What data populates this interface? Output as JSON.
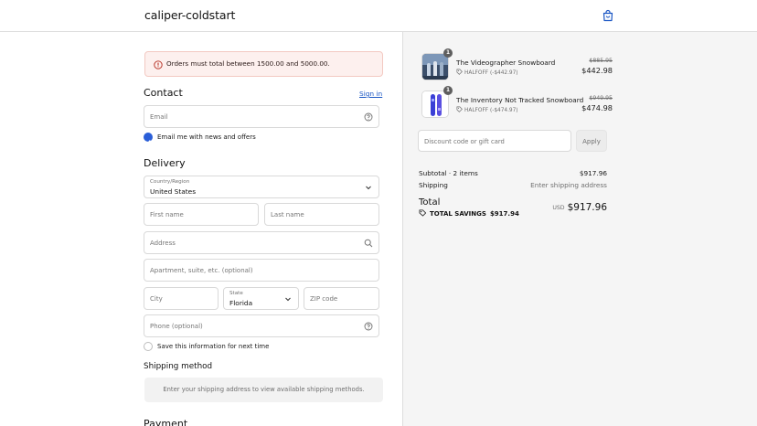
{
  "header": {
    "store_name": "caliper-coldstart",
    "cart_icon": "shopping-bag-icon"
  },
  "banner": {
    "icon": "warning-icon",
    "text": "Orders must total between 1500.00 and 5000.00."
  },
  "contact": {
    "heading": "Contact",
    "sign_in": "Sign in",
    "email_placeholder": "Email",
    "email_help_icon": "help-icon",
    "news_label": "Email me with news and offers",
    "news_checked": true
  },
  "delivery": {
    "heading": "Delivery",
    "country_label": "Country/Region",
    "country_value": "United States",
    "first_name_placeholder": "First name",
    "last_name_placeholder": "Last name",
    "address_placeholder": "Address",
    "apartment_placeholder": "Apartment, suite, etc. (optional)",
    "city_placeholder": "City",
    "state_label": "State",
    "state_value": "Florida",
    "zip_placeholder": "ZIP code",
    "phone_placeholder": "Phone (optional)",
    "save_info_label": "Save this information for next time",
    "save_info_checked": false
  },
  "shipping_method": {
    "heading": "Shipping method",
    "notice": "Enter your shipping address to view available shipping methods."
  },
  "payment": {
    "heading": "Payment"
  },
  "order": {
    "items": [
      {
        "name": "The Videographer Snowboard",
        "quantity": "1",
        "discount": "HALFOFF (-$442.97)",
        "original_price": "$885.95",
        "price": "$442.98"
      },
      {
        "name": "The Inventory Not Tracked Snowboard",
        "quantity": "1",
        "discount": "HALFOFF (-$474.97)",
        "original_price": "$949.95",
        "price": "$474.98"
      }
    ],
    "discount_placeholder": "Discount code or gift card",
    "apply_label": "Apply",
    "subtotal_label": "Subtotal · 2 items",
    "subtotal_value": "$917.96",
    "shipping_label": "Shipping",
    "shipping_value": "Enter shipping address",
    "total_label": "Total",
    "total_currency": "USD",
    "total_value": "$917.96",
    "savings_label": "TOTAL SAVINGS",
    "savings_value": "$917.94"
  },
  "colors": {
    "accent": "#2a5ed8",
    "link": "#1a56c4",
    "banner_bg": "#fdf0ee",
    "banner_border": "#f3c9c2",
    "summary_bg": "#f5f5f5"
  }
}
